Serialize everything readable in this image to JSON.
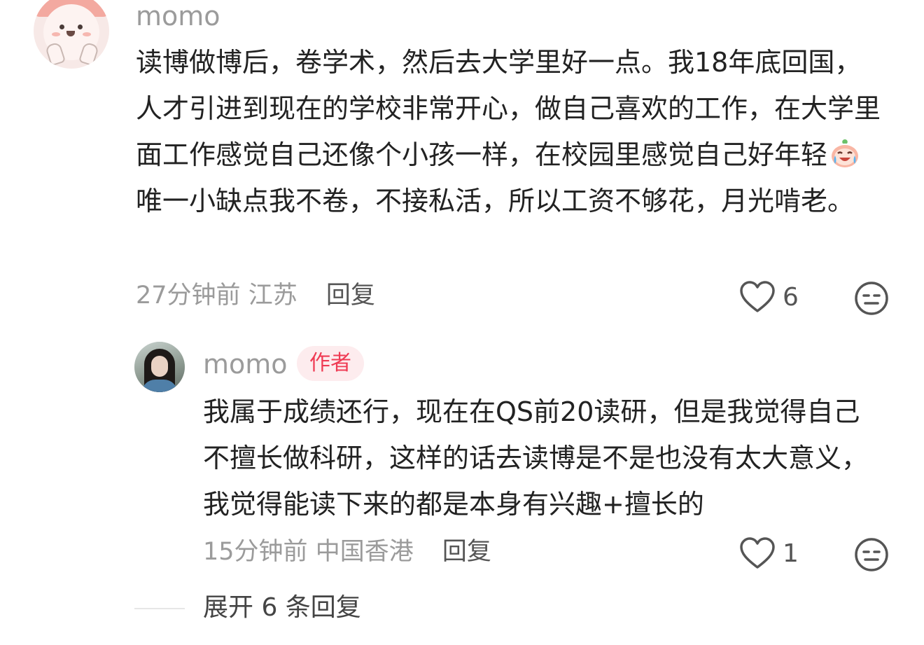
{
  "comment": {
    "username": "momo",
    "text_before_emoji": "读博做博后，卷学术，然后去大学里好一点。我18年底回国，人才引进到现在的学校非常开心，做自己喜欢的工作，在大学里面工作感觉自己还像个小孩一样，在校园里感觉自己好年轻",
    "inline_emoji": "crying-laughing-emoji",
    "text_after_emoji": "唯一小缺点我不卷，不接私活，所以工资不够花，月光啃老。",
    "time": "27分钟前",
    "location": "江苏",
    "reply_label": "回复",
    "like_count": "6"
  },
  "reply": {
    "username": "momo",
    "author_badge": "作者",
    "text": "我属于成绩还行，现在在QS前20读研，但是我觉得自己不擅长做科研，这样的话去读博是不是也没有太大意义，我觉得能读下来的都是本身有兴趣+擅长的",
    "time": "15分钟前",
    "location": "中国香港",
    "reply_label": "回复",
    "like_count": "1"
  },
  "expand_label": "展开 6 条回复",
  "icons": {
    "like": "heart-outline-icon",
    "emoji_reaction": "emoji-face-icon"
  },
  "colors": {
    "username": "#9b9b9b",
    "body_text": "#222222",
    "meta_text": "#9b9b9b",
    "author_badge_text": "#ef3b54",
    "author_badge_bg": "#fdecee"
  }
}
